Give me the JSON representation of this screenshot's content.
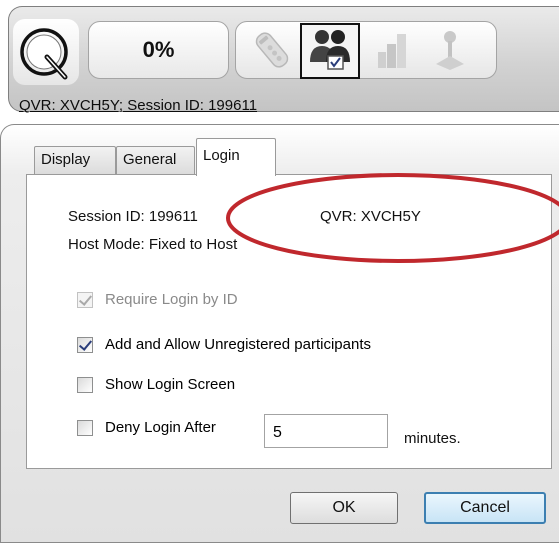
{
  "toolbar": {
    "percent": "0%",
    "session_line": "QVR: XVCH5Y; Session ID: 199611",
    "icons": [
      "logo-q-icon",
      "remote-clicker-icon",
      "participants-icon",
      "bar-chart-icon",
      "joystick-icon"
    ]
  },
  "dialog": {
    "tabs": [
      {
        "label": "Display"
      },
      {
        "label": "General"
      },
      {
        "label": "Login",
        "selected": true
      }
    ],
    "session_id_text": "Session ID: 199611",
    "qvr_text": "QVR: XVCH5Y",
    "host_mode_text": "Host Mode: Fixed to Host",
    "options": [
      {
        "label": "Require Login by ID",
        "checked": true,
        "enabled": false
      },
      {
        "label": "Add and Allow Unregistered participants",
        "checked": true,
        "enabled": true
      },
      {
        "label": "Show Login Screen",
        "checked": false,
        "enabled": true
      },
      {
        "label": "Deny Login After",
        "checked": false,
        "enabled": true
      }
    ],
    "deny_minutes_value": "5",
    "minutes_label": "minutes.",
    "ok_label": "OK",
    "cancel_label": "Cancel"
  },
  "colors": {
    "annotation_ellipse": "#c0282d",
    "default_button_border": "#3c7fb1",
    "disabled_text": "#8a8a8a"
  }
}
